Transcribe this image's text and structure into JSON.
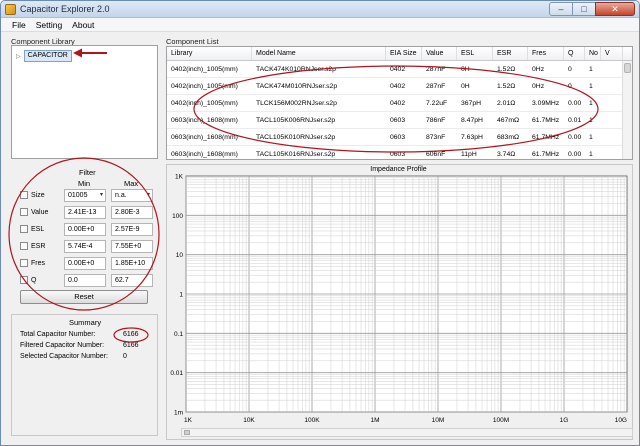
{
  "window": {
    "title": "Capacitor Explorer 2.0"
  },
  "menu": [
    "File",
    "Setting",
    "About"
  ],
  "library": {
    "label": "Component Library",
    "root": "CAPACITOR"
  },
  "components": {
    "label": "Component List",
    "columns": [
      "Library",
      "Model Name",
      "EIA Size",
      "Value",
      "ESL",
      "ESR",
      "Fres",
      "Q",
      "No",
      "V"
    ],
    "rows": [
      [
        "0402(inch)_1005(mm)",
        "TACK474K010RNJser.s2p",
        "0402",
        "287nF",
        "0H",
        "1.52Ω",
        "0Hz",
        "0",
        "1",
        ""
      ],
      [
        "0402(inch)_1005(mm)",
        "TACK474M010RNJser.s2p",
        "0402",
        "287nF",
        "0H",
        "1.52Ω",
        "0Hz",
        "0",
        "1",
        ""
      ],
      [
        "0402(inch)_1005(mm)",
        "TLCK156M002RNJser.s2p",
        "0402",
        "7.22uF",
        "367pH",
        "2.01Ω",
        "3.09MHz",
        "0.00",
        "1",
        ""
      ],
      [
        "0603(inch)_1608(mm)",
        "TACL105K006RNJser.s2p",
        "0603",
        "786nF",
        "8.47pH",
        "467mΩ",
        "61.7MHz",
        "0.01",
        "1",
        ""
      ],
      [
        "0603(inch)_1608(mm)",
        "TACL105K010RNJser.s2p",
        "0603",
        "873nF",
        "7.63pH",
        "683mΩ",
        "61.7MHz",
        "0.00",
        "1",
        ""
      ],
      [
        "0603(inch)_1608(mm)",
        "TACL105K016RNJser.s2p",
        "0603",
        "606nF",
        "11pH",
        "3.74Ω",
        "61.7MHz",
        "0.00",
        "1",
        ""
      ]
    ]
  },
  "filter": {
    "title": "Filter",
    "min_label": "Min",
    "max_label": "Max",
    "rows": [
      {
        "label": "Size",
        "min": "01005",
        "max": "n.a.",
        "dropdown": true
      },
      {
        "label": "Value",
        "min": "2.41E-13",
        "max": "2.80E-3",
        "dropdown": false
      },
      {
        "label": "ESL",
        "min": "0.00E+0",
        "max": "2.57E-9",
        "dropdown": false
      },
      {
        "label": "ESR",
        "min": "5.74E-4",
        "max": "7.55E+0",
        "dropdown": false
      },
      {
        "label": "Fres",
        "min": "0.00E+0",
        "max": "1.85E+10",
        "dropdown": false
      },
      {
        "label": "Q",
        "min": "0.0",
        "max": "62.7",
        "dropdown": false
      }
    ],
    "reset_label": "Reset"
  },
  "summary": {
    "title": "Summary",
    "rows": [
      {
        "label": "Total Capacitor Number:",
        "value": "6166"
      },
      {
        "label": "Filtered Capacitor Number:",
        "value": "6166"
      },
      {
        "label": "Selected Capacitor Number:",
        "value": "0"
      }
    ]
  },
  "chart_data": {
    "type": "line",
    "title": "Impedance Profile",
    "xlabel": "",
    "ylabel": "",
    "x_scale": "log",
    "y_scale": "log",
    "xlim": [
      1000,
      10000000000
    ],
    "ylim": [
      0.001,
      1000
    ],
    "x_ticks": [
      "1K",
      "10K",
      "100K",
      "1M",
      "10M",
      "100M",
      "1G",
      "10G"
    ],
    "y_ticks": [
      "1K",
      "100",
      "10",
      "1",
      "0.1",
      "0.01",
      "1m"
    ],
    "grid": true,
    "series": []
  },
  "colors": {
    "annotation": "#b0141e",
    "selection": "#dbe8f8"
  }
}
